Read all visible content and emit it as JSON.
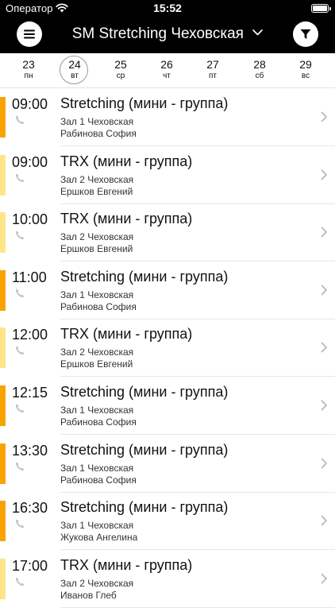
{
  "status_bar": {
    "carrier": "Оператор",
    "time": "15:52"
  },
  "nav": {
    "title": "SM Stretching Чеховская"
  },
  "days": [
    {
      "num": "23",
      "dow": "пн",
      "selected": false
    },
    {
      "num": "24",
      "dow": "вт",
      "selected": true
    },
    {
      "num": "25",
      "dow": "ср",
      "selected": false
    },
    {
      "num": "26",
      "dow": "чт",
      "selected": false
    },
    {
      "num": "27",
      "dow": "пт",
      "selected": false
    },
    {
      "num": "28",
      "dow": "сб",
      "selected": false
    },
    {
      "num": "29",
      "dow": "вс",
      "selected": false
    }
  ],
  "colors": {
    "stretching": "#f7a400",
    "trx": "#ffe58a",
    "nav_bg": "#000000"
  },
  "classes": [
    {
      "time": "09:00",
      "title": "Stretching (мини - группа)",
      "room": "Зал 1 Чеховская",
      "trainer": "Рабинова София",
      "kind": "stretching"
    },
    {
      "time": "09:00",
      "title": "TRX (мини - группа)",
      "room": "Зал 2 Чеховская",
      "trainer": "Ершков Евгений",
      "kind": "trx"
    },
    {
      "time": "10:00",
      "title": "TRX (мини - группа)",
      "room": "Зал 2 Чеховская",
      "trainer": "Ершков Евгений",
      "kind": "trx"
    },
    {
      "time": "11:00",
      "title": "Stretching (мини - группа)",
      "room": "Зал 1 Чеховская",
      "trainer": "Рабинова София",
      "kind": "stretching"
    },
    {
      "time": "12:00",
      "title": "TRX (мини - группа)",
      "room": "Зал 2 Чеховская",
      "trainer": "Ершков Евгений",
      "kind": "trx"
    },
    {
      "time": "12:15",
      "title": "Stretching (мини - группа)",
      "room": "Зал 1 Чеховская",
      "trainer": "Рабинова София",
      "kind": "stretching"
    },
    {
      "time": "13:30",
      "title": "Stretching (мини - группа)",
      "room": "Зал 1 Чеховская",
      "trainer": "Рабинова София",
      "kind": "stretching"
    },
    {
      "time": "16:30",
      "title": "Stretching (мини - группа)",
      "room": "Зал 1 Чеховская",
      "trainer": "Жукова Ангелина",
      "kind": "stretching"
    },
    {
      "time": "17:00",
      "title": "TRX (мини - группа)",
      "room": "Зал 2 Чеховская",
      "trainer": "Иванов Глеб",
      "kind": "trx"
    }
  ]
}
